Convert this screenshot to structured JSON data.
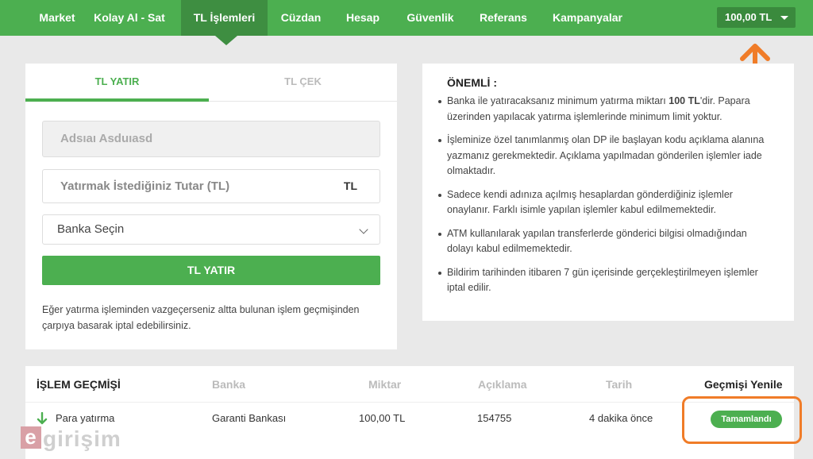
{
  "nav": {
    "items": [
      "Market",
      "Kolay Al - Sat",
      "TL İşlemleri",
      "Cüzdan",
      "Hesap",
      "Güvenlik",
      "Referans",
      "Kampanyalar"
    ],
    "active_index": 2,
    "balance": "100,00 TL"
  },
  "deposit": {
    "tab_deposit": "TL YATIR",
    "tab_withdraw": "TL ÇEK",
    "name_value": "Adsıaı Asduıasd",
    "amount_placeholder": "Yatırmak İstediğiniz Tutar (TL)",
    "amount_unit": "TL",
    "bank_select": "Banka Seçin",
    "submit_label": "TL YATIR",
    "note": "Eğer yatırma işleminden vazgeçerseniz altta bulunan işlem geçmişinden çarpıya basarak iptal edebilirsiniz."
  },
  "important": {
    "title": "ÖNEMLİ :",
    "item1_pre": "Banka ile yatıracaksanız minimum yatırma miktarı ",
    "item1_bold": "100 TL",
    "item1_post": "'dir. Papara üzerinden yapılacak yatırma işlemlerinde minimum limit yoktur.",
    "item2": "İşleminize özel tanımlanmış olan DP ile başlayan kodu açıklama alanına yazmanız gerekmektedir. Açıklama yapılmadan gönderilen işlemler iade olmaktadır.",
    "item3": "Sadece kendi adınıza açılmış hesaplardan gönderdiğiniz işlemler onaylanır. Farklı isimle yapılan işlemler kabul edilmemektedir.",
    "item4": "ATM kullanılarak yapılan transferlerde gönderici bilgisi olmadığından dolayı kabul edilmemektedir.",
    "item5": "Bildirim tarihinden itibaren 7 gün içerisinde gerçekleştirilmeyen işlemler iptal edilir."
  },
  "history": {
    "title": "İŞLEM GEÇMİŞİ",
    "col_bank": "Banka",
    "col_amount": "Miktar",
    "col_desc": "Açıklama",
    "col_date": "Tarih",
    "refresh": "Geçmişi Yenile",
    "rows": [
      {
        "type": "Para yatırma",
        "bank": "Garanti Bankası",
        "amount": "100,00 TL",
        "desc": "154755",
        "date": "4 dakika önce",
        "status": "Tamamlandı"
      }
    ]
  },
  "watermark": {
    "e": "e",
    "rest": "girişim"
  },
  "colors": {
    "primary": "#4caf50",
    "primary_dark": "#3e8e41",
    "annotation": "#f07c28"
  }
}
